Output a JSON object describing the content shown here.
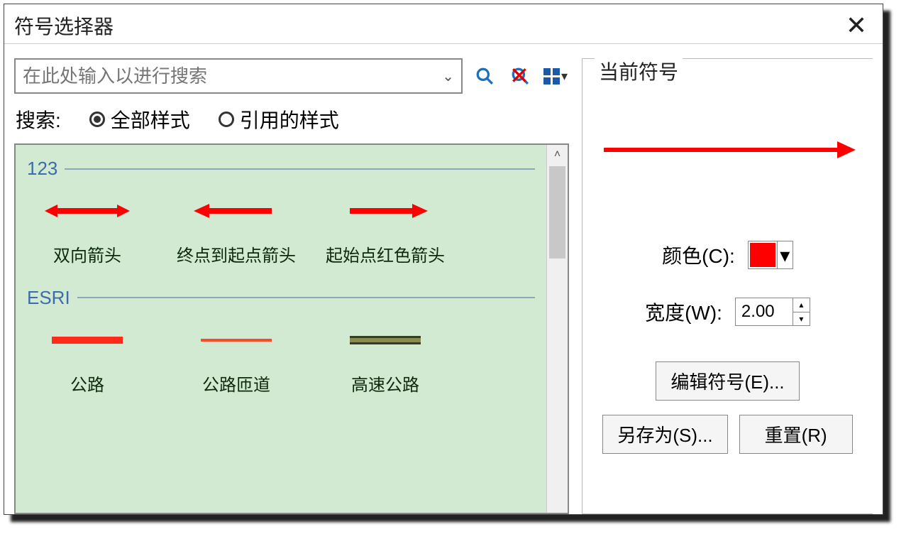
{
  "window": {
    "title": "符号选择器"
  },
  "search": {
    "placeholder": "在此处输入以进行搜索",
    "label": "搜索:"
  },
  "filters": {
    "all_styles": "全部样式",
    "referenced_styles": "引用的样式"
  },
  "groups": {
    "g1": {
      "name": "123"
    },
    "g2": {
      "name": "ESRI"
    }
  },
  "items": {
    "g1": [
      {
        "label": "双向箭头"
      },
      {
        "label": "终点到起点箭头"
      },
      {
        "label": "起始点红色箭头"
      }
    ],
    "g2": [
      {
        "label": "公路"
      },
      {
        "label": "公路匝道"
      },
      {
        "label": "高速公路"
      }
    ]
  },
  "right": {
    "legend": "当前符号",
    "color_label": "颜色(C):",
    "color_value": "#ff0000",
    "width_label": "宽度(W):",
    "width_value": "2.00",
    "edit_button": "编辑符号(E)...",
    "save_as_button": "另存为(S)...",
    "reset_button": "重置(R)"
  }
}
